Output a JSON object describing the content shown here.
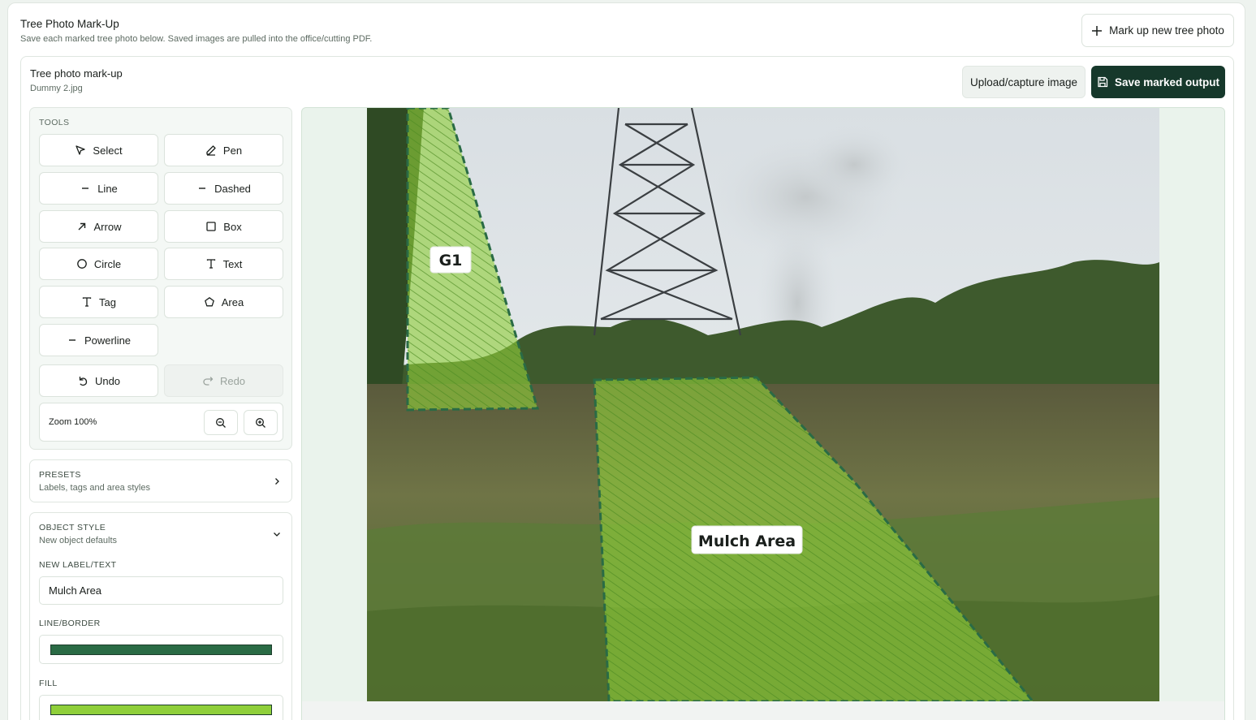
{
  "header": {
    "title": "Tree Photo Mark-Up",
    "subtitle": "Save each marked tree photo below. Saved images are pulled into the office/cutting PDF.",
    "new_button": "Mark up new tree photo"
  },
  "panel": {
    "title": "Tree photo mark-up",
    "filename": "Dummy 2.jpg",
    "upload_button": "Upload/capture image",
    "save_button": "Save marked output"
  },
  "tools": {
    "label": "TOOLS",
    "items": [
      {
        "label": "Select",
        "icon": "pointer-icon"
      },
      {
        "label": "Pen",
        "icon": "pen-icon"
      },
      {
        "label": "Line",
        "icon": "line-icon"
      },
      {
        "label": "Dashed",
        "icon": "dashed-icon"
      },
      {
        "label": "Arrow",
        "icon": "arrow-icon"
      },
      {
        "label": "Box",
        "icon": "box-icon"
      },
      {
        "label": "Circle",
        "icon": "circle-icon"
      },
      {
        "label": "Text",
        "icon": "text-icon"
      },
      {
        "label": "Tag",
        "icon": "tag-icon"
      },
      {
        "label": "Area",
        "icon": "polygon-icon"
      },
      {
        "label": "Powerline",
        "icon": "powerline-icon"
      }
    ],
    "undo": "Undo",
    "redo": "Redo",
    "zoom_text": "Zoom 100%"
  },
  "presets": {
    "title": "PRESETS",
    "subtitle": "Labels, tags and area styles"
  },
  "object_style": {
    "title": "OBJECT STYLE",
    "subtitle": "New object defaults",
    "label_field": "NEW LABEL/TEXT",
    "label_value": "Mulch Area",
    "border_field": "LINE/BORDER",
    "border_color": "#2a6b45",
    "fill_field": "FILL",
    "fill_color": "#8fcf3a"
  },
  "canvas": {
    "annotations": [
      {
        "label": "G1"
      },
      {
        "label": "Mulch Area"
      }
    ]
  }
}
